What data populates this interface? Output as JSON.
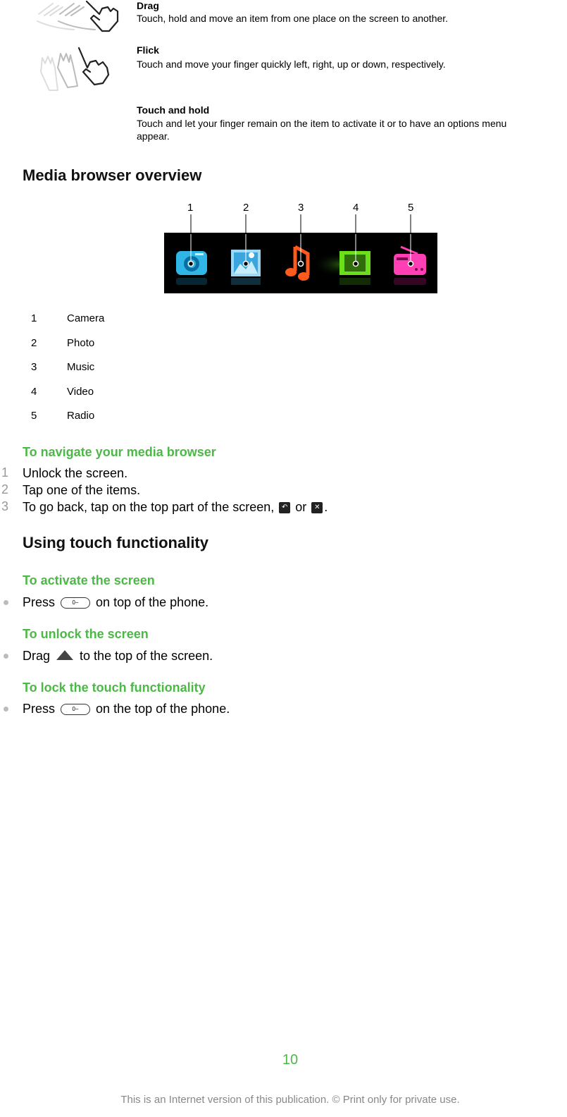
{
  "gestures": [
    {
      "title": "Drag",
      "description": "Touch, hold and move an item from one place on the screen to another.",
      "icon": "drag-hand-icon"
    },
    {
      "title": "Flick",
      "description": "Touch and move your finger quickly left, right, up or down, respectively.",
      "icon": "flick-hand-icon"
    },
    {
      "title": "Touch and hold",
      "description_line1": "Touch and let your finger remain on the item to activate it or to have an options menu",
      "description_line2": "appear."
    }
  ],
  "media_overview": {
    "heading": "Media browser overview",
    "callouts": [
      "1",
      "2",
      "3",
      "4",
      "5"
    ],
    "icons": [
      {
        "name": "camera-icon",
        "color": "#2fb5e6"
      },
      {
        "name": "photo-icon",
        "color": "#4cb3e6"
      },
      {
        "name": "music-icon",
        "color": "#ff5a1e"
      },
      {
        "name": "video-icon",
        "color": "#6be01a"
      },
      {
        "name": "radio-icon",
        "color": "#ff3fb3"
      }
    ],
    "legend": [
      {
        "num": "1",
        "label": "Camera"
      },
      {
        "num": "2",
        "label": "Photo"
      },
      {
        "num": "3",
        "label": "Music"
      },
      {
        "num": "4",
        "label": "Video"
      },
      {
        "num": "5",
        "label": "Radio"
      }
    ]
  },
  "navigate": {
    "heading": "To navigate your media browser",
    "steps": [
      {
        "num": "1",
        "text": "Unlock the screen."
      },
      {
        "num": "2",
        "text": "Tap one of the items."
      },
      {
        "num": "3",
        "text_before": "To go back, tap on the top part of the screen,",
        "text_or": "or",
        "text_after": "."
      }
    ],
    "back_icon": "↶",
    "close_icon": "✕"
  },
  "touch": {
    "heading": "Using touch functionality",
    "activate": {
      "heading": "To activate the screen",
      "before": "Press",
      "after": "on top of the phone."
    },
    "unlock": {
      "heading": "To unlock the screen",
      "before": "Drag",
      "after": "to the top of the screen."
    },
    "lock": {
      "heading": "To lock the touch functionality",
      "before": "Press",
      "after": "on the top of the phone."
    },
    "key_glyph": "0−"
  },
  "footer": {
    "page_number": "10",
    "notice": "This is an Internet version of this publication. © Print only for private use."
  },
  "colors": {
    "accent": "#4cb946",
    "bullet": "#bbbbbb",
    "step_number": "#999999"
  }
}
